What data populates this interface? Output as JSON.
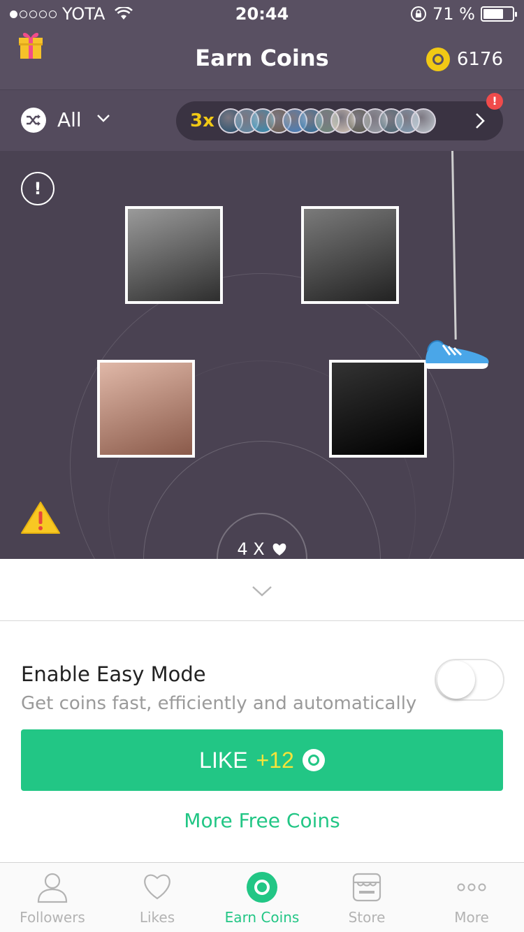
{
  "status": {
    "carrier": "YOTA",
    "time": "20:44",
    "battery_text": "71 %",
    "battery_level": 0.71
  },
  "header": {
    "title": "Earn Coins",
    "coins": "6176"
  },
  "filter": {
    "label": "All",
    "multiplier": "3x",
    "badge": "!"
  },
  "game": {
    "multiplier_text": "4 X",
    "info_label": "!",
    "photos": [
      {
        "name": "photo-woman-fountain",
        "colors": [
          "#9a9a9a",
          "#2e2e2e"
        ]
      },
      {
        "name": "photo-street-people",
        "colors": [
          "#7a7a7a",
          "#222222"
        ]
      },
      {
        "name": "photo-girl-bear-ears",
        "colors": [
          "#e0b8a8",
          "#8a5a4a"
        ]
      },
      {
        "name": "photo-woman-quote",
        "colors": [
          "#333333",
          "#000000"
        ]
      }
    ]
  },
  "panel": {
    "easy_title": "Enable Easy Mode",
    "easy_subtitle": "Get coins fast, efficiently and automatically",
    "easy_enabled": false,
    "like_label": "LIKE",
    "like_reward": "+12",
    "more_coins": "More Free Coins"
  },
  "tabs": [
    {
      "label": "Followers",
      "icon": "person-icon",
      "active": false
    },
    {
      "label": "Likes",
      "icon": "heart-icon",
      "active": false
    },
    {
      "label": "Earn Coins",
      "icon": "coin-icon",
      "active": true
    },
    {
      "label": "Store",
      "icon": "store-icon",
      "active": false
    },
    {
      "label": "More",
      "icon": "more-icon",
      "active": false
    }
  ],
  "colors": {
    "header": "#595062",
    "game_bg": "#4a4252",
    "accent": "#22c685",
    "coin": "#f1c915"
  }
}
